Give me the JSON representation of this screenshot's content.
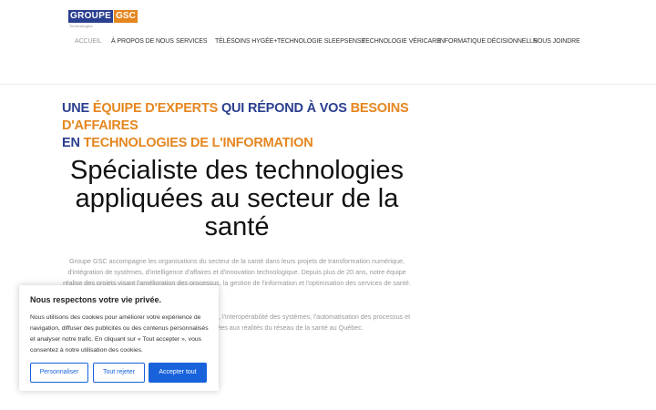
{
  "header": {
    "logo": {
      "left": "GROUPE",
      "right": "GSC",
      "tagline": "Technologies"
    },
    "nav": [
      {
        "label": "ACCUEIL",
        "active": true
      },
      {
        "label": "À PROPOS DE NOUS"
      },
      {
        "label": "SERVICES"
      },
      {
        "label": "TÉLÉSOINS HYGÉE+"
      },
      {
        "label": "TECHNOLOGIE SLEEPSENSE"
      },
      {
        "label": "TECHNOLOGIE VÉRICARE"
      },
      {
        "label": "INFORMATIQUE DÉCISIONNELLE"
      },
      {
        "label": "NOUS JOINDRE"
      }
    ]
  },
  "hero": {
    "tagline": {
      "w1": "UNE",
      "w2": "ÉQUIPE D'EXPERTS",
      "w3": "QUI RÉPOND À VOS",
      "w4": "BESOINS D'AFFAIRES",
      "w5": "EN",
      "w6": "TECHNOLOGIES DE L'INFORMATION"
    },
    "title": "Spécialiste des technologies appliquées au secteur de la santé",
    "paragraph1": "Groupe GSC accompagne les organisations du secteur de la santé dans leurs projets de transformation numérique, d'intégration de systèmes, d'intelligence d'affaires et d'innovation technologique. Depuis plus de 20 ans, notre équipe réalise des projets visant l'amélioration des processus, la gestion de l'information et l'optimisation des services de santé.",
    "paragraph2": "Nous intervenons notamment en analyse de données, l'interopérabilité des systèmes, l'automatisation des processus et le développement de solutions adaptées aux réalités du réseau de la santé au Québec."
  },
  "cookie": {
    "title": "Nous respectons votre vie privée.",
    "text": "Nous utilisons des cookies pour améliorer votre expérience de navigation, diffuser des publicités ou des contenus personnalisés et analyser notre trafic. En cliquant sur « Tout accepter », vous consentez à notre utilisation des cookies.",
    "btn_customize": "Personnaliser",
    "btn_reject": "Tout rejeter",
    "btn_accept": "Accepter tout"
  },
  "colors": {
    "brand_blue": "#2b3f8f",
    "brand_orange": "#e5861f",
    "button_blue": "#1863dc"
  }
}
